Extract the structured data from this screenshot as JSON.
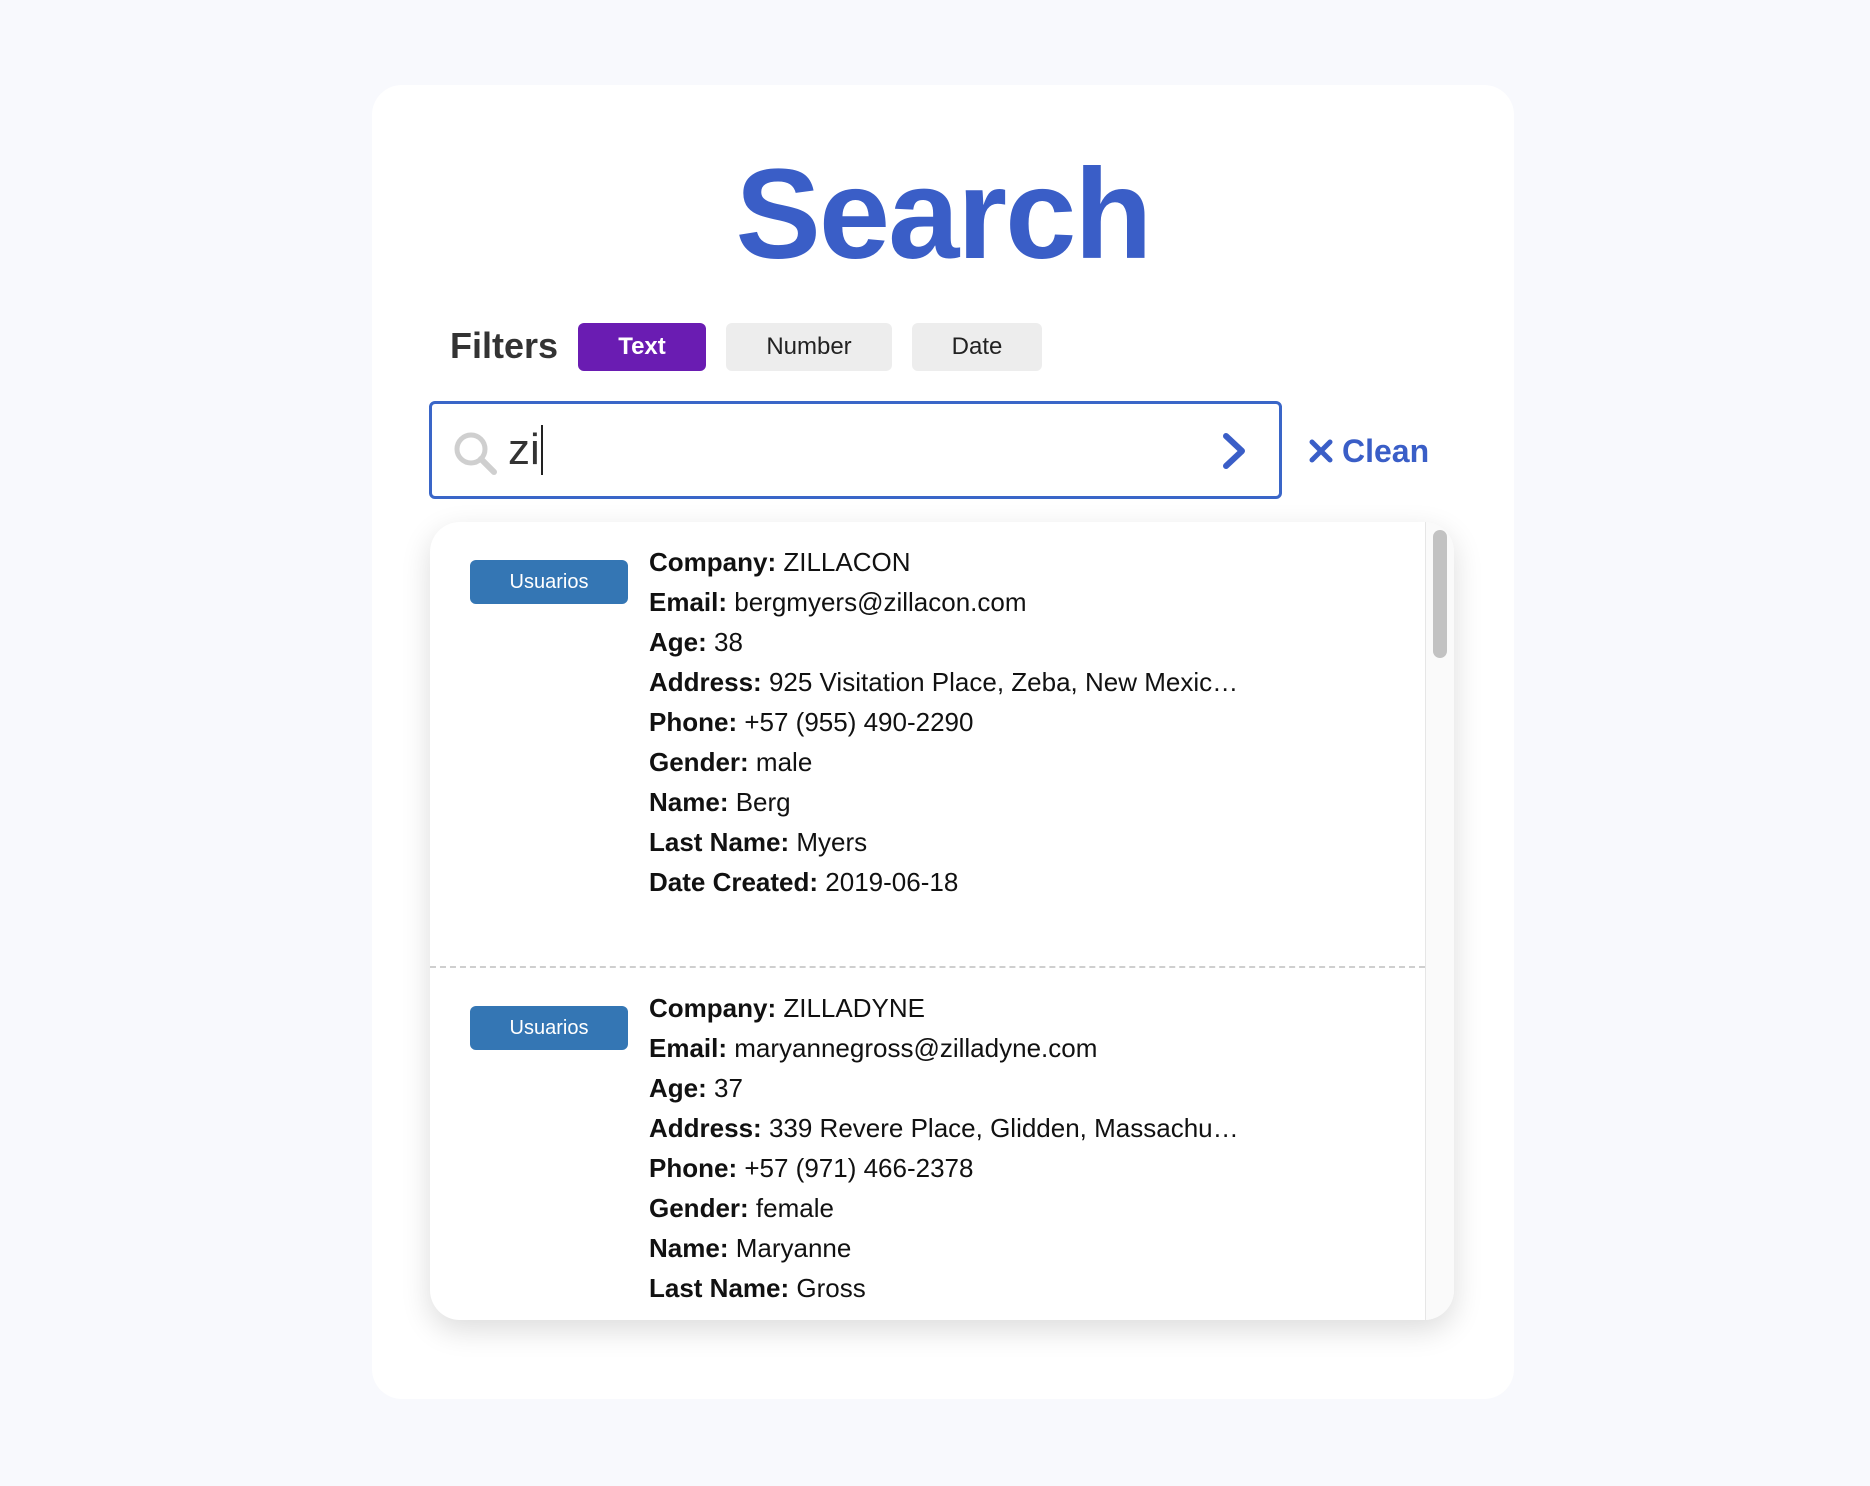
{
  "page": {
    "title": "Search",
    "accent_color": "#3a5ec7",
    "active_filter_color": "#6a1cb2",
    "badge_color": "#3476b4"
  },
  "filters": {
    "label": "Filters",
    "options": [
      {
        "label": "Text",
        "active": true
      },
      {
        "label": "Number",
        "active": false
      },
      {
        "label": "Date",
        "active": false
      }
    ]
  },
  "search": {
    "value": "zi",
    "icon": "search-icon",
    "submit_icon": "chevron-right-icon"
  },
  "clean": {
    "label": "Clean",
    "icon": "close-icon"
  },
  "results": [
    {
      "badge": "Usuarios",
      "fields": [
        {
          "label": "Company:",
          "value": "ZILLACON"
        },
        {
          "label": "Email:",
          "value": "bergmyers@zillacon.com"
        },
        {
          "label": "Age:",
          "value": "38"
        },
        {
          "label": "Address:",
          "value": "925 Visitation Place, Zeba, New Mexic…"
        },
        {
          "label": "Phone:",
          "value": "+57 (955) 490-2290"
        },
        {
          "label": "Gender:",
          "value": "male"
        },
        {
          "label": "Name:",
          "value": "Berg"
        },
        {
          "label": "Last Name:",
          "value": "Myers"
        },
        {
          "label": "Date Created:",
          "value": "2019-06-18"
        }
      ]
    },
    {
      "badge": "Usuarios",
      "fields": [
        {
          "label": "Company:",
          "value": "ZILLADYNE"
        },
        {
          "label": "Email:",
          "value": "maryannegross@zilladyne.com"
        },
        {
          "label": "Age:",
          "value": "37"
        },
        {
          "label": "Address:",
          "value": "339 Revere Place, Glidden, Massachu…"
        },
        {
          "label": "Phone:",
          "value": "+57 (971) 466-2378"
        },
        {
          "label": "Gender:",
          "value": "female"
        },
        {
          "label": "Name:",
          "value": "Maryanne"
        },
        {
          "label": "Last Name:",
          "value": "Gross"
        }
      ]
    }
  ]
}
